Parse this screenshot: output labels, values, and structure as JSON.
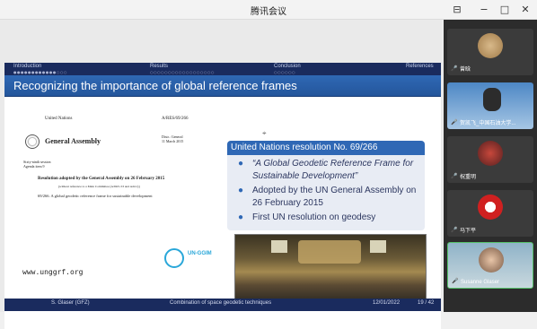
{
  "window": {
    "title": "腾讯会议",
    "minimize_glyph": "−",
    "maximize_glyph": "□",
    "close_glyph": "✕",
    "tile_glyph": "⊟"
  },
  "slide": {
    "nav": [
      "Introduction",
      "Results",
      "Conclusion",
      "References"
    ],
    "title": "Recognizing the importance of global reference frames",
    "document": {
      "org": "United Nations",
      "ref": "A/RES/69/266",
      "body": "General Assembly",
      "dist": "Distr.: General\n11 March 2015",
      "session": "Sixty-ninth session\nAgenda item 9",
      "resolution_line": "Resolution adopted by the General Assembly on 26 February 2015",
      "without_ref": "[without reference to a Main Committee (A/69/L.53 and Add.1)]",
      "item": "69/266.   A global geodetic reference frame for sustainable development"
    },
    "ggim_label": "UN-GGIM",
    "url": "www.unggrf.org",
    "box": {
      "heading": "United Nations resolution No. 69/266",
      "bullets": [
        "“A Global Geodetic Reference Frame for Sustainable Development”",
        "Adopted by the UN General Assembly on 26 February 2015",
        "First UN resolution on geodesy"
      ]
    },
    "footer": {
      "author": "S. Glaser  (GFZ)",
      "talk": "Combination of space geodetic techniques",
      "date": "12/01/2022",
      "page": "19 / 42"
    }
  },
  "participants": [
    {
      "name": "曾晗"
    },
    {
      "name": "贺凯飞_中国石油大学..."
    },
    {
      "name": "祝重明"
    },
    {
      "name": "马下平"
    },
    {
      "name": "Susanne Glaser"
    }
  ],
  "icons": [
    "minimize-icon",
    "maximize-icon",
    "close-icon",
    "mic-icon",
    "un-emblem-icon",
    "ggim-logo-icon"
  ]
}
